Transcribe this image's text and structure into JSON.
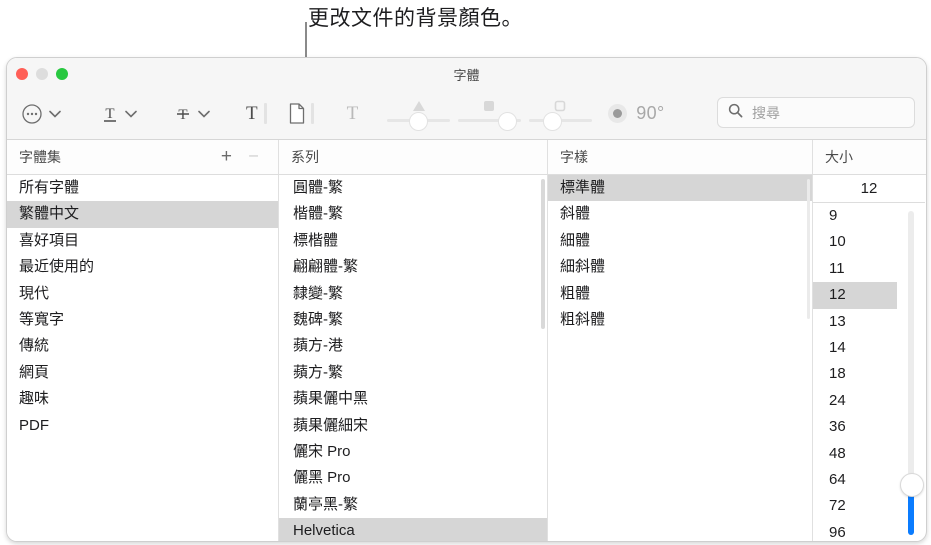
{
  "callout": {
    "text": "更改文件的背景顏色。",
    "points_to": "document-background-color-button"
  },
  "window": {
    "title": "字體",
    "traffic_lights": {
      "close": "close-button",
      "minimize": "minimize-button",
      "zoom": "zoom-button"
    }
  },
  "toolbar": {
    "action_menu": "…",
    "chevron": "⌄",
    "underline_glyph": "T",
    "strikethrough_glyph": "T",
    "text_color_glyph": "T",
    "document_bg_glyph": "page",
    "shadow_glyph": "T",
    "angle_label": "90°",
    "sliders": [
      {
        "name": "shadow-opacity-slider",
        "cap": "triangle"
      },
      {
        "name": "shadow-blur-slider",
        "cap": "filled-square"
      },
      {
        "name": "shadow-offset-slider",
        "cap": "outlined-square"
      }
    ]
  },
  "search": {
    "placeholder": "搜尋",
    "value": "",
    "icon": "search-icon"
  },
  "columns": {
    "collections": "字體集",
    "family": "系列",
    "typeface": "字樣",
    "size": "大小",
    "add_label": "+",
    "remove_label": "–"
  },
  "collections": {
    "items": [
      {
        "label": "所有字體",
        "selected": false
      },
      {
        "label": "繁體中文",
        "selected": true
      },
      {
        "label": "喜好項目",
        "selected": false
      },
      {
        "label": "最近使用的",
        "selected": false
      },
      {
        "label": "現代",
        "selected": false
      },
      {
        "label": "等寬字",
        "selected": false
      },
      {
        "label": "傳統",
        "selected": false
      },
      {
        "label": "網頁",
        "selected": false
      },
      {
        "label": "趣味",
        "selected": false
      },
      {
        "label": "PDF",
        "selected": false
      }
    ]
  },
  "families": {
    "items": [
      {
        "label": "圓體-繁",
        "selected": false
      },
      {
        "label": "楷體-繁",
        "selected": false
      },
      {
        "label": "標楷體",
        "selected": false
      },
      {
        "label": "翩翩體-繁",
        "selected": false
      },
      {
        "label": "隸變-繁",
        "selected": false
      },
      {
        "label": "魏碑-繁",
        "selected": false
      },
      {
        "label": "蘋方-港",
        "selected": false
      },
      {
        "label": "蘋方-繁",
        "selected": false
      },
      {
        "label": "蘋果儷中黑",
        "selected": false
      },
      {
        "label": "蘋果儷細宋",
        "selected": false
      },
      {
        "label": "儷宋 Pro",
        "selected": false
      },
      {
        "label": "儷黑 Pro",
        "selected": false
      },
      {
        "label": "蘭亭黑-繁",
        "selected": false
      },
      {
        "label": "Helvetica",
        "selected": true
      }
    ]
  },
  "typefaces": {
    "items": [
      {
        "label": "標準體",
        "selected": true
      },
      {
        "label": "斜體",
        "selected": false
      },
      {
        "label": "細體",
        "selected": false
      },
      {
        "label": "細斜體",
        "selected": false
      },
      {
        "label": "粗體",
        "selected": false
      },
      {
        "label": "粗斜體",
        "selected": false
      }
    ]
  },
  "sizes": {
    "current_value": "12",
    "items": [
      {
        "label": "9",
        "selected": false
      },
      {
        "label": "10",
        "selected": false
      },
      {
        "label": "11",
        "selected": false
      },
      {
        "label": "12",
        "selected": true
      },
      {
        "label": "13",
        "selected": false
      },
      {
        "label": "14",
        "selected": false
      },
      {
        "label": "18",
        "selected": false
      },
      {
        "label": "24",
        "selected": false
      },
      {
        "label": "36",
        "selected": false
      },
      {
        "label": "48",
        "selected": false
      },
      {
        "label": "64",
        "selected": false
      },
      {
        "label": "72",
        "selected": false
      },
      {
        "label": "96",
        "selected": false
      }
    ]
  },
  "colors": {
    "selection": "#d6d6d6",
    "slider_fill": "#0a7cff",
    "close": "#ff5f57",
    "minimize": "#dddddd",
    "zoom": "#28c840",
    "toolbar_bg": "#f6f6f6"
  }
}
